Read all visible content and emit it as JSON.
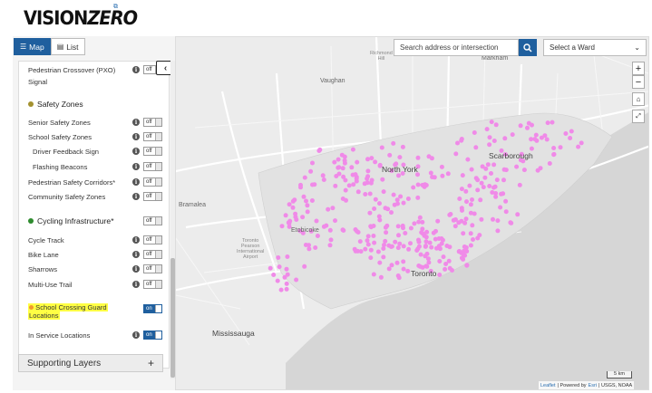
{
  "logo": {
    "vision": "VISION",
    "zero": "ZERO",
    "ext_icon": "external-link-icon"
  },
  "tabs": [
    {
      "label": "Map",
      "icon": "map-list-icon",
      "active": true
    },
    {
      "label": "List",
      "icon": "list-icon",
      "active": false
    }
  ],
  "search": {
    "placeholder": "Search address or intersection",
    "icon": "search-icon"
  },
  "ward_select": {
    "selected": "Select a Ward"
  },
  "layers": {
    "pxo": {
      "label": "Pedestrian Crossover (PXO)",
      "label2": "Signal",
      "state": "off"
    },
    "safety_zones": {
      "title": "Safety Zones",
      "color": "#a3912f"
    },
    "senior": {
      "label": "Senior Safety Zones",
      "state": "off"
    },
    "school": {
      "label": "School Safety Zones",
      "state": "off"
    },
    "driver": {
      "label": "Driver Feedback Sign",
      "state": "off"
    },
    "flashing": {
      "label": "Flashing Beacons",
      "state": "off"
    },
    "ped_corr": {
      "label": "Pedestrian Safety Corridors*",
      "state": "off"
    },
    "community": {
      "label": "Community Safety Zones",
      "state": "off"
    },
    "cycling": {
      "title": "Cycling Infrastructure*",
      "color": "#2e8b2e",
      "state": "off"
    },
    "cycle_track": {
      "label": "Cycle Track",
      "state": "off"
    },
    "bike_lane": {
      "label": "Bike Lane",
      "state": "off"
    },
    "sharrows": {
      "label": "Sharrows",
      "state": "off"
    },
    "multi_use": {
      "label": "Multi-Use Trail",
      "state": "off"
    },
    "guard": {
      "label": "School Crossing Guard",
      "label2": "Locations",
      "state": "on",
      "color": "#f29a2e"
    },
    "in_service": {
      "label": "In Service Locations",
      "state": "on"
    }
  },
  "supporting": {
    "label": "Supporting Layers",
    "plus": "+"
  },
  "map_labels": {
    "richmond_hill": "Richmond\nHill",
    "markham": "Markham",
    "vaughan": "Vaughan",
    "north_york": "North York",
    "scarborough": "Scarborough",
    "etobicoke": "Etobicoke",
    "toronto": "Toronto",
    "bramalea": "Bramalea",
    "pearson": "Toronto\nPearson\nInternational\nAirport",
    "mississauga": "Mississauga"
  },
  "map_controls": {
    "zoom_in": "+",
    "zoom_out": "−",
    "home": "home-icon",
    "fullscreen": "fullscreen-icon"
  },
  "scale": "5 km",
  "attribution": {
    "leaflet": "Leaflet",
    "powered": "| Powered by",
    "esri": "Esri",
    "rest": "| USGS, NOAA"
  },
  "marker_color": "#f08ae8"
}
